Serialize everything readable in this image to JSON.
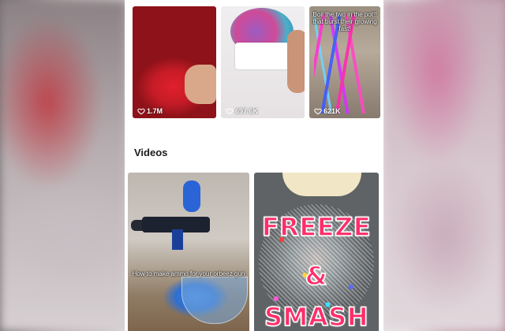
{
  "top_grid": [
    {
      "caption": "",
      "likes": "1.7M"
    },
    {
      "caption": "",
      "likes": "697.6K"
    },
    {
      "caption": "Boil the two in the pot!! that burst their growing fast!",
      "likes": "621K"
    }
  ],
  "section_title": "Videos",
  "videos": [
    {
      "caption": "How to make ammo for your orbeez gun",
      "overlay": []
    },
    {
      "caption": "",
      "overlay": [
        "FREEZE",
        "&",
        "SMASH"
      ]
    }
  ],
  "icons": {
    "like": "heart-icon"
  },
  "colors": {
    "overlay_text": "#ff2d6a",
    "background": "#ffffff"
  }
}
